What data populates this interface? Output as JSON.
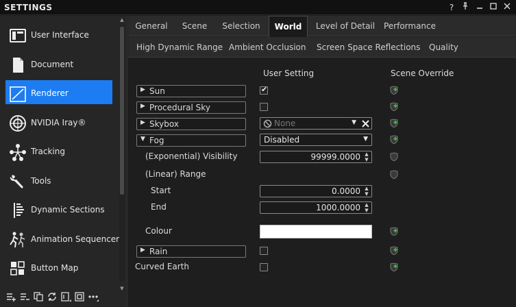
{
  "window": {
    "title": "SETTINGS",
    "controls": [
      "?",
      "⊣",
      "—",
      "☐",
      "✕"
    ]
  },
  "sidebar": {
    "items": [
      {
        "label": "User Interface",
        "icon": "user-interface-icon",
        "active": false
      },
      {
        "label": "Document",
        "icon": "document-icon",
        "active": false
      },
      {
        "label": "Renderer",
        "icon": "renderer-icon",
        "active": true
      },
      {
        "label": "NVIDIA Iray®",
        "icon": "nvidia-iray-icon",
        "active": false
      },
      {
        "label": "Tracking",
        "icon": "tracking-icon",
        "active": false
      },
      {
        "label": "Tools",
        "icon": "wrench-icon",
        "active": false
      },
      {
        "label": "Dynamic Sections",
        "icon": "dynamic-sections-icon",
        "active": false
      },
      {
        "label": "Animation Sequencer",
        "icon": "animation-sequencer-icon",
        "active": false
      },
      {
        "label": "Button Map",
        "icon": "button-map-icon",
        "active": false
      }
    ],
    "toolbar_icons": [
      "add-icon",
      "remove-icon",
      "copy-icon",
      "sync-icon",
      "layout-icon",
      "frame-icon",
      "more-icon"
    ]
  },
  "tabs_primary": {
    "items": [
      "General",
      "Scene",
      "Selection",
      "World",
      "Level of Detail",
      "Performance"
    ],
    "active": "World"
  },
  "tabs_secondary": {
    "items": [
      "High Dynamic Range",
      "Ambient Occlusion",
      "Screen Space Reflections",
      "Quality"
    ]
  },
  "columns": {
    "user_setting": "User Setting",
    "scene_override": "Scene Override"
  },
  "rows": {
    "sun": {
      "label": "Sun",
      "checked": true
    },
    "procedural_sky": {
      "label": "Procedural Sky",
      "checked": false
    },
    "skybox": {
      "label": "Skybox",
      "value": "None"
    },
    "fog": {
      "label": "Fog",
      "value": "Disabled"
    },
    "visibility": {
      "label": "(Exponential) Visibility",
      "value": "99999.0000"
    },
    "linear_range": {
      "label": "(Linear) Range"
    },
    "start": {
      "label": "Start",
      "value": "0.0000"
    },
    "end": {
      "label": "End",
      "value": "1000.0000"
    },
    "colour": {
      "label": "Colour",
      "value_color": "#ffffff"
    },
    "rain": {
      "label": "Rain",
      "checked": false
    },
    "curved_earth": {
      "label": "Curved Earth",
      "checked": false
    }
  },
  "colors": {
    "accent": "#1d7cf2",
    "override_green": "#3fbf3f"
  }
}
